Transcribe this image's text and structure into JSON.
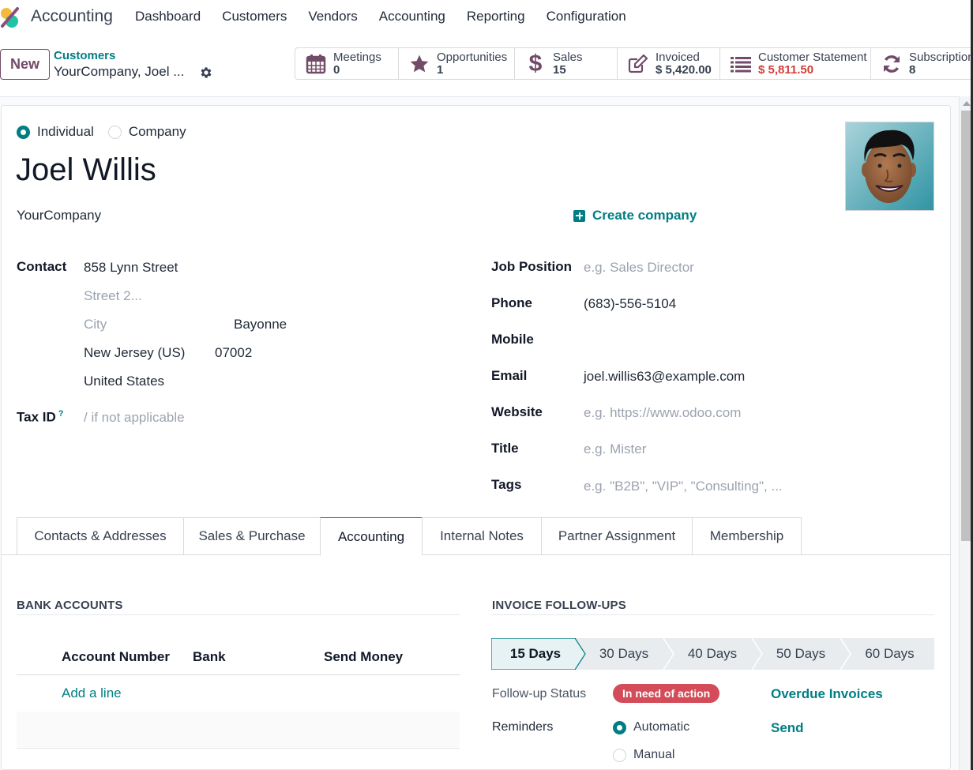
{
  "app": {
    "name": "Accounting",
    "menu": [
      "Dashboard",
      "Customers",
      "Vendors",
      "Accounting",
      "Reporting",
      "Configuration"
    ]
  },
  "control_panel": {
    "new_label": "New",
    "breadcrumb_parent": "Customers",
    "breadcrumb_current": "YourCompany, Joel ...",
    "smart_buttons": [
      {
        "icon": "calendar-icon",
        "label": "Meetings",
        "value": "0",
        "value_color": "default"
      },
      {
        "icon": "star-icon",
        "label": "Opportunities",
        "value": "1",
        "value_color": "default"
      },
      {
        "icon": "dollar-icon",
        "label": "Sales",
        "value": "15",
        "value_color": "default"
      },
      {
        "icon": "edit-icon",
        "label": "Invoiced",
        "value": "$ 5,420.00",
        "value_color": "default"
      },
      {
        "icon": "list-icon",
        "label": "Customer Statement",
        "value": "$ 5,811.50",
        "value_color": "#d23f3a"
      },
      {
        "icon": "refresh-icon",
        "label": "Subscriptions",
        "value": "8",
        "value_color": "default"
      }
    ]
  },
  "form": {
    "company_type": {
      "options": [
        "Individual",
        "Company"
      ],
      "selected": "Individual"
    },
    "name": "Joel Willis",
    "parent_company": "YourCompany",
    "create_company_label": "Create company",
    "address": {
      "label": "Contact",
      "street": "858 Lynn Street",
      "street2_placeholder": "Street 2...",
      "city_placeholder": "City",
      "city": "Bayonne",
      "state": "New Jersey (US)",
      "zip": "07002",
      "country": "United States"
    },
    "tax_id": {
      "label": "Tax ID",
      "help": "?",
      "placeholder": "/ if not applicable"
    },
    "right_fields": [
      {
        "label": "Job Position",
        "value": "",
        "placeholder": "e.g. Sales Director"
      },
      {
        "label": "Phone",
        "value": "(683)-556-5104",
        "placeholder": ""
      },
      {
        "label": "Mobile",
        "value": "",
        "placeholder": ""
      },
      {
        "label": "Email",
        "value": "joel.willis63@example.com",
        "placeholder": ""
      },
      {
        "label": "Website",
        "value": "",
        "placeholder": "e.g. https://www.odoo.com"
      },
      {
        "label": "Title",
        "value": "",
        "placeholder": "e.g. Mister"
      },
      {
        "label": "Tags",
        "value": "",
        "placeholder": "e.g. \"B2B\", \"VIP\", \"Consulting\", ..."
      }
    ]
  },
  "tabs": {
    "items": [
      "Contacts & Addresses",
      "Sales & Purchase",
      "Accounting",
      "Internal Notes",
      "Partner Assignment",
      "Membership"
    ],
    "active": "Accounting"
  },
  "bank_accounts": {
    "title": "BANK ACCOUNTS",
    "columns": [
      "Account Number",
      "Bank",
      "Send Money"
    ],
    "rows": [],
    "add_line": "Add a line"
  },
  "invoice_followups": {
    "title": "INVOICE FOLLOW-UPS",
    "stages": [
      "15 Days",
      "30 Days",
      "40 Days",
      "50 Days",
      "60 Days"
    ],
    "active_stage": "15 Days",
    "status_label": "Follow-up Status",
    "status_value": "In need of action",
    "overdue_link": "Overdue Invoices",
    "reminders_label": "Reminders",
    "reminder_options": [
      "Automatic",
      "Manual"
    ],
    "reminder_selected": "Automatic",
    "send_label": "Send"
  },
  "colors": {
    "brand": "#714b67",
    "accent": "#017e84",
    "danger": "#d44c59"
  }
}
